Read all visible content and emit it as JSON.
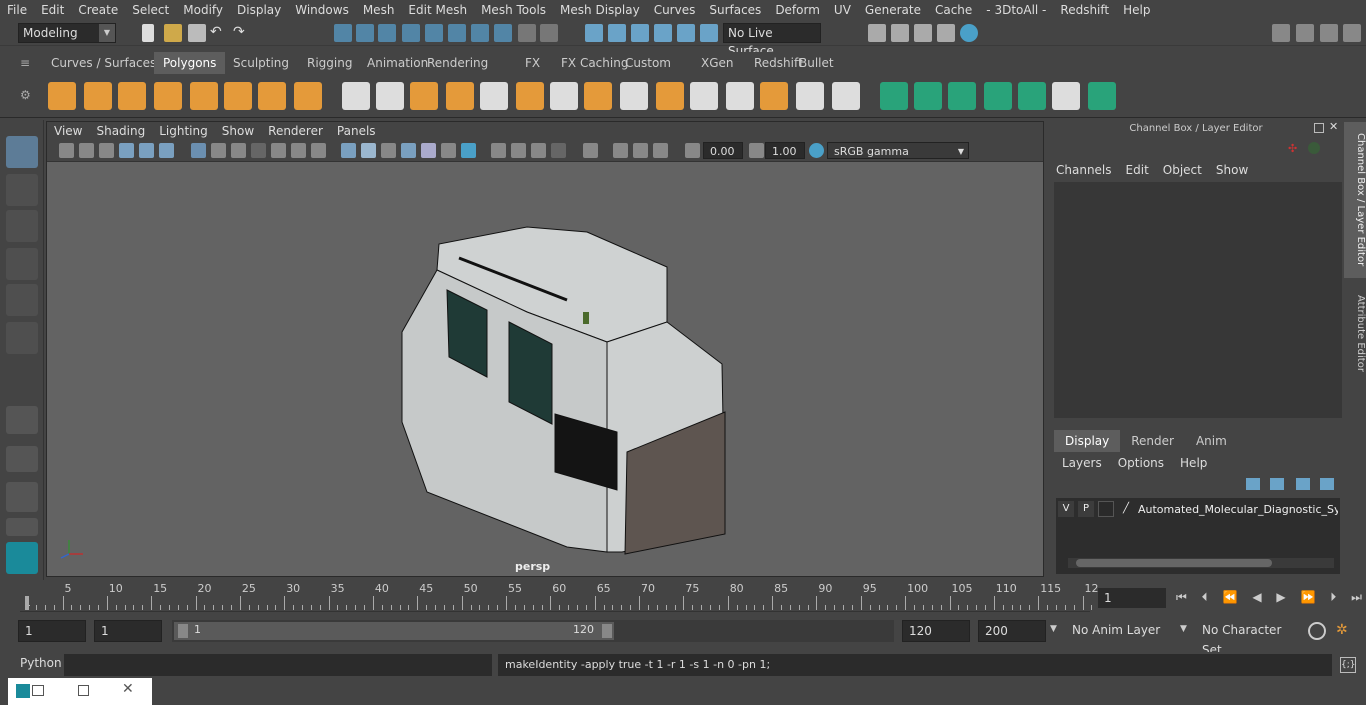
{
  "menubar": {
    "items": [
      "File",
      "Edit",
      "Create",
      "Select",
      "Modify",
      "Display",
      "Windows",
      "Mesh",
      "Edit Mesh",
      "Mesh Tools",
      "Mesh Display",
      "Curves",
      "Surfaces",
      "Deform",
      "UV",
      "Generate",
      "Cache",
      "- 3DtoAll -",
      "Redshift",
      "Help"
    ]
  },
  "status": {
    "workspace": "Modeling",
    "live_surface": "No Live Surface"
  },
  "shelf": {
    "tabs": [
      "Curves / Surfaces",
      "Polygons",
      "Sculpting",
      "Rigging",
      "Animation",
      "Rendering",
      "FX",
      "FX Caching",
      "Custom",
      "XGen",
      "Redshift",
      "Bullet"
    ],
    "active_tab": "Polygons"
  },
  "viewport": {
    "menus": [
      "View",
      "Shading",
      "Lighting",
      "Show",
      "Renderer",
      "Panels"
    ],
    "exposure": "0.00",
    "gamma": "1.00",
    "color_space": "sRGB gamma",
    "camera": "persp"
  },
  "channelbox": {
    "title": "Channel Box / Layer Editor",
    "menus": [
      "Channels",
      "Edit",
      "Object",
      "Show"
    ],
    "tabs": [
      "Display",
      "Render",
      "Anim"
    ],
    "active_tab": "Display",
    "layer_menus": [
      "Layers",
      "Options",
      "Help"
    ],
    "layer": {
      "v": "V",
      "p": "P",
      "name": "Automated_Molecular_Diagnostic_Syst"
    }
  },
  "sidetabs": {
    "channel": "Channel Box / Layer Editor",
    "attr": "Attribute Editor"
  },
  "timeline": {
    "ticks": [
      "5",
      "10",
      "15",
      "20",
      "25",
      "30",
      "35",
      "40",
      "45",
      "50",
      "55",
      "60",
      "65",
      "70",
      "75",
      "80",
      "85",
      "90",
      "95",
      "100",
      "105",
      "110",
      "115",
      "12"
    ],
    "start_marker": "1",
    "current_frame": "1"
  },
  "range": {
    "start": "1",
    "playback_start": "1",
    "range_start": "1",
    "range_end": "120",
    "playback_end": "120",
    "end": "200",
    "anim_layer": "No Anim Layer",
    "char_set": "No Character Set"
  },
  "cmd": {
    "lang": "Python",
    "output": "makeIdentity -apply true -t 1 -r 1 -s 1 -n 0 -pn 1;"
  },
  "colors": {
    "accent": "#5285a6",
    "shelf_orange": "#e49a3a",
    "shelf_green": "#29a37a"
  }
}
